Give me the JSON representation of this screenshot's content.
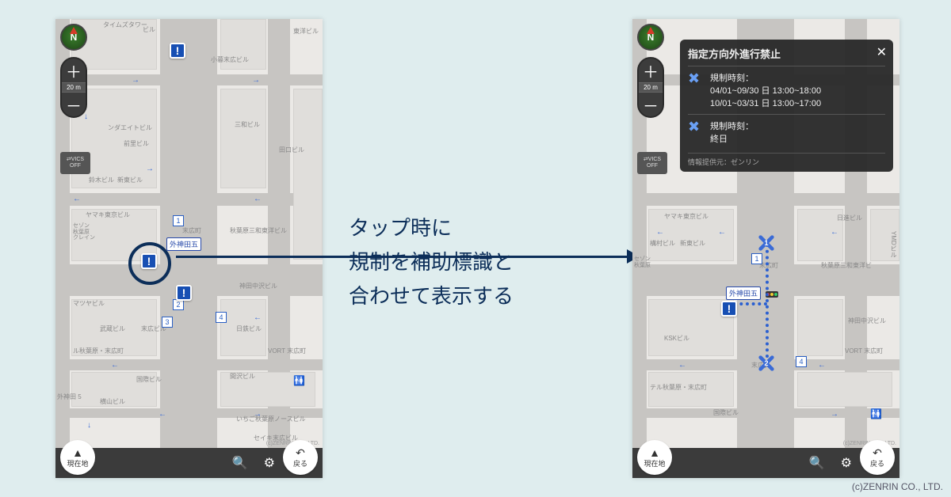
{
  "caption": {
    "line1": "タップ時に",
    "line2": "規制を補助標識と",
    "line3": "合わせて表示する"
  },
  "copyright": "(c)ZENRIN CO., LTD.",
  "map": {
    "scale": "20 m",
    "vics_line1": "⇄VICS",
    "vics_line2": "OFF",
    "location_btn": "現在地",
    "back_btn": "戻る",
    "map_credit": "(c)ZENRIN CO., LTD.",
    "intersection": "外神田五",
    "labels": {
      "a": "タイムズタワー",
      "b": "東洋ビル",
      "c": "小暮末広ビル",
      "d": "ンダエイトビル",
      "e": "前里ビル",
      "f": "三和ビル",
      "g": "田口ビル",
      "h": "ヤマキ東京ビル",
      "i": "秋葉原三和東洋ビル",
      "j": "末広町",
      "k": "神田中沢ビル",
      "l": "マツヤビル",
      "m": "武蔵ビル",
      "n": "末広ビル",
      "o": "日鉄ビル",
      "p": "VORT 末広町",
      "q": "国際ビル",
      "r": "横山ビル",
      "s": "間沢ビル",
      "t": "いちご秋葉原ノースビル",
      "u": "ル秋葉原・末広町",
      "v": "外神田 5",
      "w": "鈴木ビル",
      "x": "新東ビル",
      "y": "KSKビル",
      "z": "セイキ末広ビル",
      "r2a": "日進ビル",
      "r2b": "構村ビル",
      "r2c": "新東ビル",
      "r2d": "テル秋葉原・末広町",
      "r2e": "YMDビル"
    }
  },
  "popup": {
    "title": "指定方向外進行禁止",
    "r1_label": "規制時刻：",
    "r1_line1": "04/01~09/30 日 13:00~18:00",
    "r1_line2": "10/01~03/31 日 13:00~17:00",
    "r2_label": "規制時刻：",
    "r2_line1": "終日",
    "footer": "情報提供元：ゼンリン"
  }
}
